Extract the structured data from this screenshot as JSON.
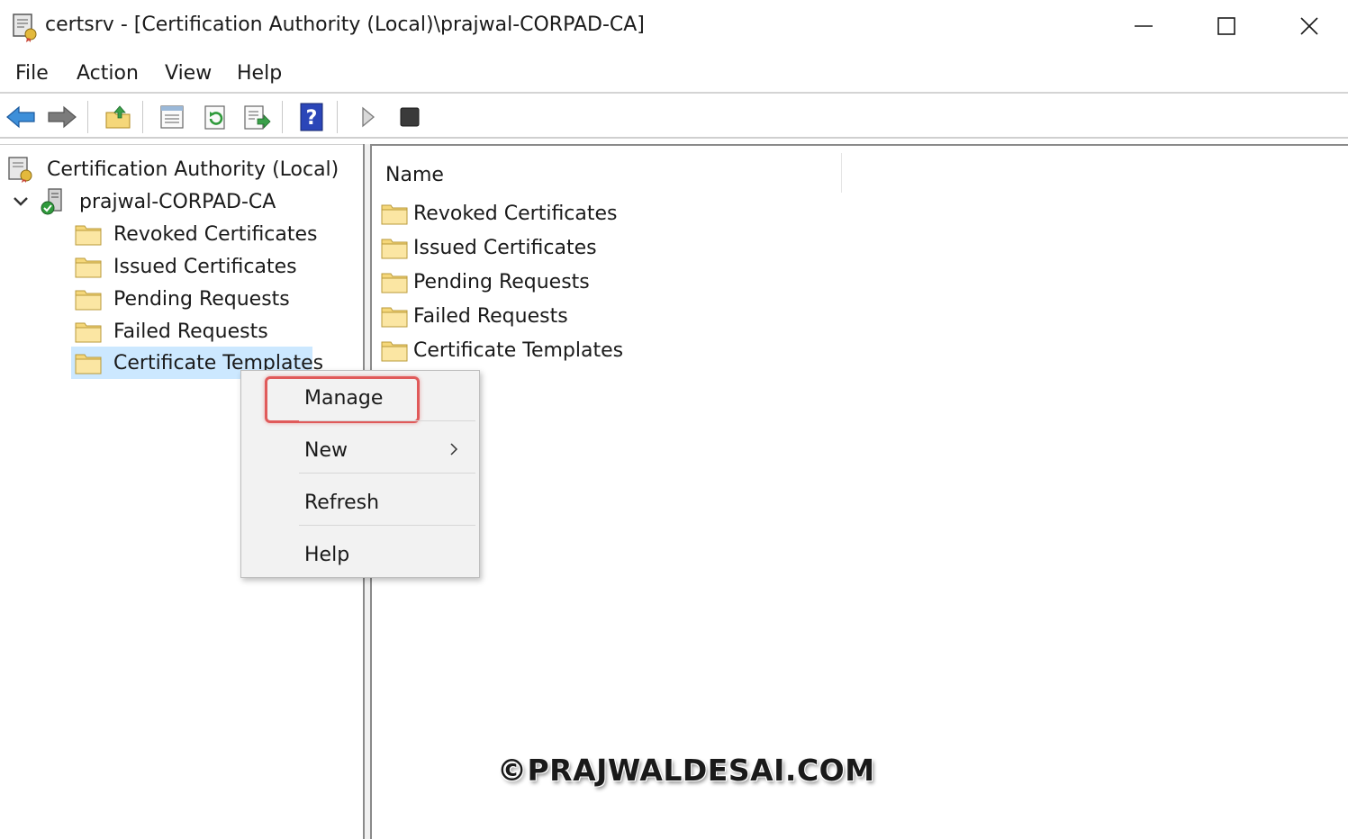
{
  "window": {
    "title": "certsrv - [Certification Authority (Local)\\prajwal-CORPAD-CA]",
    "minimize_icon": "minimize-icon",
    "maximize_icon": "maximize-icon",
    "close_icon": "close-icon"
  },
  "menubar": {
    "items": [
      {
        "label": "File"
      },
      {
        "label": "Action"
      },
      {
        "label": "View"
      },
      {
        "label": "Help"
      }
    ]
  },
  "toolbar": {
    "buttons": [
      {
        "icon": "back-arrow-icon"
      },
      {
        "icon": "forward-arrow-icon"
      },
      {
        "icon": "up-folder-icon"
      },
      {
        "icon": "properties-icon"
      },
      {
        "icon": "refresh-icon"
      },
      {
        "icon": "export-list-icon"
      },
      {
        "icon": "help-icon"
      },
      {
        "icon": "start-service-icon"
      },
      {
        "icon": "stop-service-icon"
      }
    ]
  },
  "tree": {
    "root_label": "Certification Authority (Local)",
    "ca_label": "prajwal-CORPAD-CA",
    "children": [
      {
        "label": "Revoked Certificates"
      },
      {
        "label": "Issued Certificates"
      },
      {
        "label": "Pending Requests"
      },
      {
        "label": "Failed Requests"
      },
      {
        "label": "Certificate Templates",
        "selected": true
      }
    ]
  },
  "list": {
    "column_header": "Name",
    "rows": [
      {
        "label": "Revoked Certificates"
      },
      {
        "label": "Issued Certificates"
      },
      {
        "label": "Pending Requests"
      },
      {
        "label": "Failed Requests"
      },
      {
        "label": "Certificate Templates"
      }
    ]
  },
  "context_menu": {
    "items": [
      {
        "label": "Manage",
        "highlighted": true
      },
      {
        "label": "New",
        "has_submenu": true
      },
      {
        "label": "Refresh"
      },
      {
        "label": "Help"
      }
    ],
    "highlight_color": "#e05a5a"
  },
  "watermark": "©PRAJWALDESAI.COM",
  "colors": {
    "selection": "#cce8ff",
    "folder": "#f5d77a",
    "help_blue": "#2b46b8"
  }
}
